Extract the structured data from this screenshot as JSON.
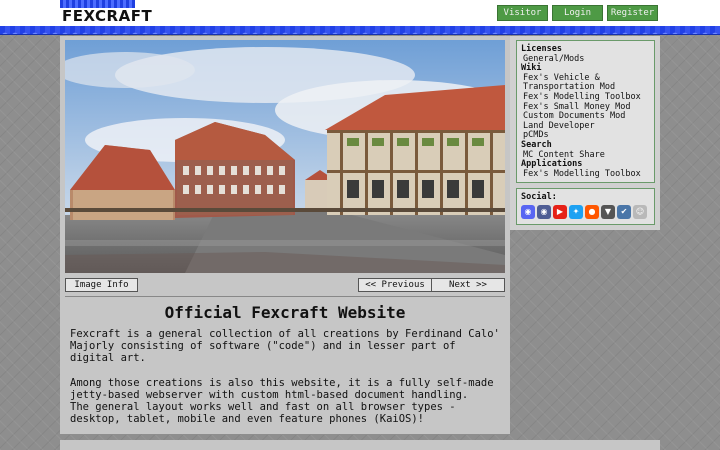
{
  "site": {
    "logo_text": "FEXCRAFT"
  },
  "nav": {
    "visitor": "Visitor",
    "login": "Login",
    "register": "Register"
  },
  "gallery": {
    "image_info": "Image Info",
    "previous": "<< Previous",
    "next": "Next >>"
  },
  "content": {
    "title": "Official Fexcraft Website",
    "para1": "Fexcraft is a general collection of all creations by Ferdinand Calo'\nMajorly consisting of software (\"code\") and in lesser part of digital art.",
    "para2": "Among those creations is also this website, it is a fully self-made jetty-based webserver with custom html-based document handling.\nThe general layout works well and fast on all browser types - desktop, tablet, mobile and even feature phones (KaiOS)!"
  },
  "sidebar": {
    "sections": [
      {
        "heading": "Licenses",
        "items": [
          "General/Mods"
        ]
      },
      {
        "heading": "Wiki",
        "items": [
          "Fex's Vehicle &\nTransportation Mod",
          "Fex's Modelling Toolbox",
          "Fex's Small Money Mod",
          "Custom Documents Mod",
          "Land Developer",
          "pCMDs"
        ]
      },
      {
        "heading": "Search",
        "items": [
          "MC Content Share"
        ]
      },
      {
        "heading": "Applications",
        "items": [
          "Fex's Modelling Toolbox"
        ]
      }
    ],
    "social": {
      "label": "Social:",
      "icons": [
        {
          "name": "discord-icon",
          "color": "#5865f2"
        },
        {
          "name": "discord-alt-icon",
          "color": "#4e5d94"
        },
        {
          "name": "youtube-icon",
          "color": "#e62117"
        },
        {
          "name": "twitter-icon",
          "color": "#1da1f2"
        },
        {
          "name": "reddit-icon",
          "color": "#ff5700"
        },
        {
          "name": "curseforge-icon",
          "color": "#555555"
        },
        {
          "name": "vk-icon",
          "color": "#4a76a8"
        },
        {
          "name": "bot-icon",
          "color": "#b9b9b9"
        }
      ]
    }
  }
}
